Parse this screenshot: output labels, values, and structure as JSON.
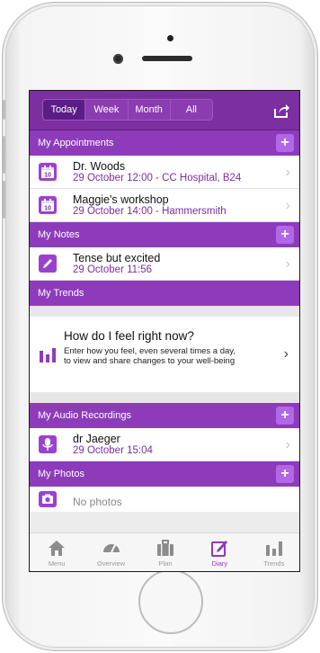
{
  "segmented": {
    "items": [
      "Today",
      "Week",
      "Month",
      "All"
    ],
    "active": "Today"
  },
  "appointments": {
    "title": "My Appointments",
    "items": [
      {
        "name": "Dr. Woods",
        "detail": "29 October 12:00 - CC Hospital, B24",
        "icon_text": "10"
      },
      {
        "name": "Maggie's workshop",
        "detail": "29 October 14:00 - Hammersmith",
        "icon_text": "10"
      }
    ]
  },
  "notes": {
    "title": "My Notes",
    "items": [
      {
        "name": "Tense but excited",
        "detail": "29 October 11:56"
      }
    ]
  },
  "trends": {
    "title": "My Trends",
    "card_title": "How do I feel right now?",
    "card_desc": "Enter how you feel, even several times a day, to view and share changes to your well-being"
  },
  "audio": {
    "title": "My Audio Recordings",
    "items": [
      {
        "name": "dr Jaeger",
        "detail": "29 October 15:04"
      }
    ]
  },
  "photos": {
    "title": "My Photos",
    "empty": "No photos"
  },
  "tabbar": {
    "items": [
      {
        "label": "Menu",
        "icon": "home-icon"
      },
      {
        "label": "Overview",
        "icon": "gauge-icon"
      },
      {
        "label": "Plan",
        "icon": "briefcase-icon"
      },
      {
        "label": "Diary",
        "icon": "pencil-icon"
      },
      {
        "label": "Trends",
        "icon": "bar-chart-icon"
      }
    ],
    "active": "Diary"
  },
  "colors": {
    "accent": "#8d3bbb",
    "dark": "#7b2fa0",
    "plus": "#b266e8"
  }
}
